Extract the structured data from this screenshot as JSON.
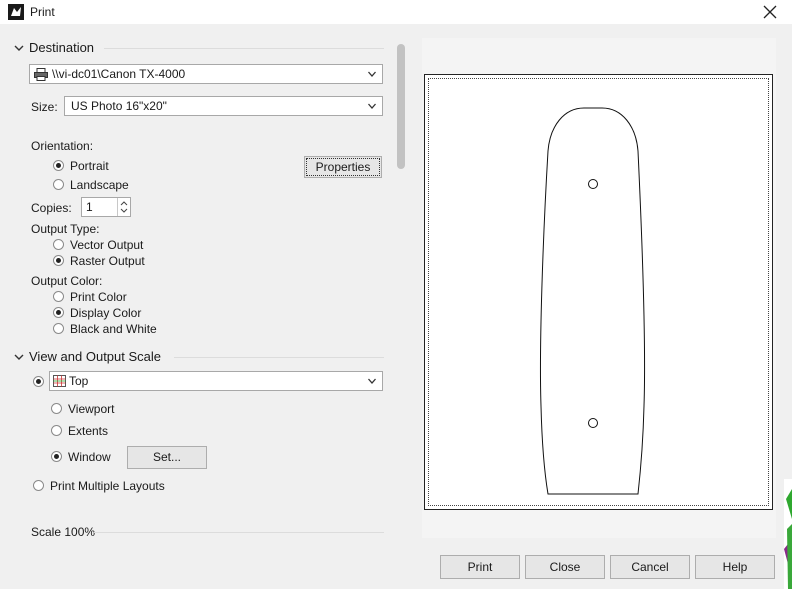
{
  "window": {
    "title": "Print"
  },
  "destination": {
    "header": "Destination",
    "printer": "\\\\vi-dc01\\Canon TX-4000",
    "size_label": "Size:",
    "size_value": "US Photo 16\"x20\"",
    "orientation_label": "Orientation:",
    "portrait": "Portrait",
    "landscape": "Landscape",
    "properties_button": "Properties",
    "copies_label": "Copies:",
    "copies_value": "1",
    "output_type_label": "Output Type:",
    "vector_output": "Vector Output",
    "raster_output": "Raster Output",
    "output_color_label": "Output Color:",
    "print_color": "Print Color",
    "display_color": "Display Color",
    "black_and_white": "Black and White"
  },
  "view_scale": {
    "header": "View and Output Scale",
    "view_value": "Top",
    "viewport": "Viewport",
    "extents": "Extents",
    "window": "Window",
    "set_button": "Set...",
    "print_multiple_layouts": "Print Multiple Layouts",
    "scale": "Scale 100%"
  },
  "footer": {
    "print": "Print",
    "close": "Close",
    "cancel": "Cancel",
    "help": "Help"
  },
  "state": {
    "orientation": "portrait",
    "output_type": "raster",
    "output_color": "display",
    "view_mode": "window"
  }
}
